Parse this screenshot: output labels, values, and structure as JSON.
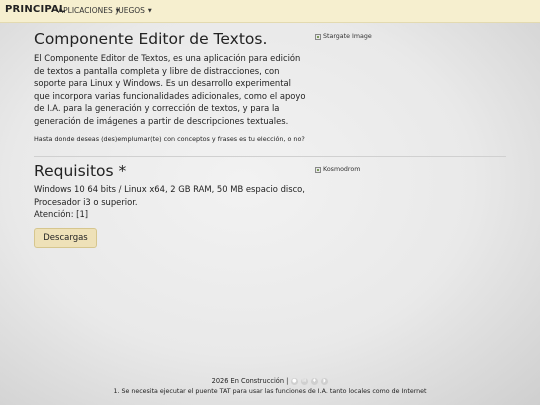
{
  "navbar": {
    "brand": "PRINCIPAL",
    "items": [
      {
        "label": "APLICACIONES"
      },
      {
        "label": "JUEGOS"
      }
    ]
  },
  "editor_section": {
    "title": "Componente Editor de Textos.",
    "description": "El Componente Editor de Textos, es una aplicación para edición de textos a pantalla completa y libre de distracciones, con soporte para Linux y Windows. Es un desarrollo experimental que incorpora varias funcionalidades adicionales, como el apoyo de I.A. para la generación y corrección de textos, y para la generación de imágenes a partir de descripciones textuales.",
    "question": "Hasta donde deseas (des)emplumar(te) con conceptos y frases es tu elección, o no?",
    "image_alt": "Stargate Image"
  },
  "requirements_section": {
    "title": "Requisitos *",
    "specs": "Windows 10 64 bits / Linux x64, 2 GB RAM, 50 MB espacio disco, Procesador i3 o superior.",
    "attention": "Atención: [1]",
    "image_alt": "Kosmodrom",
    "download_label": "Descargas"
  },
  "footer": {
    "status": "2026 En Construcción |",
    "icons": [
      "github-icon",
      "mail-icon",
      "twitter-icon",
      "rss-icon"
    ],
    "footnote": "1. Se necesita ejecutar el puente TAT para usar las funciones de I.A. tanto locales como de Internet"
  }
}
